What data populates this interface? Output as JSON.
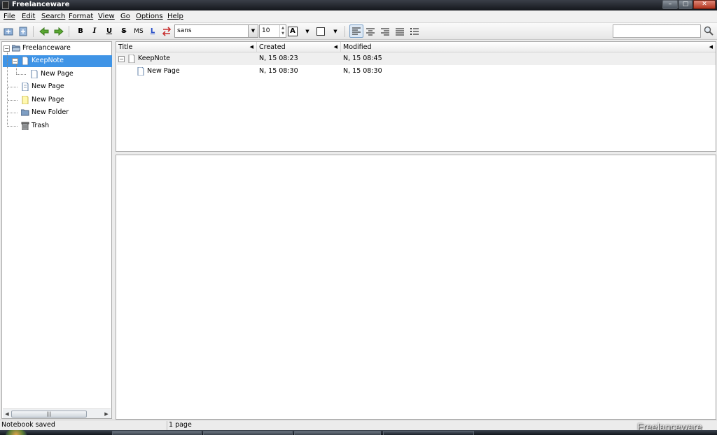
{
  "window": {
    "title": "Freelanceware",
    "controls": {
      "minimize": "–",
      "maximize": "▢",
      "close": "✕"
    }
  },
  "menu": [
    "File",
    "Edit",
    "Search",
    "Format",
    "View",
    "Go",
    "Options",
    "Help"
  ],
  "toolbar": {
    "bold": "B",
    "italic": "I",
    "underline": "U",
    "strike": "S",
    "monospace": "MS",
    "link": "L",
    "font_color_label": "A",
    "font_family": "sans",
    "font_size": "10"
  },
  "tree": {
    "root": "Freelanceware",
    "items": [
      {
        "label": "KeepNote",
        "level": 1,
        "icon": "page-icon",
        "selected": true
      },
      {
        "label": "New Page",
        "level": 2,
        "icon": "page-icon"
      },
      {
        "label": "New Page",
        "level": 1,
        "icon": "page-icon"
      },
      {
        "label": "New Page",
        "level": 1,
        "icon": "yellow-page-icon"
      },
      {
        "label": "New Folder",
        "level": 1,
        "icon": "folder-icon"
      },
      {
        "label": "Trash",
        "level": 1,
        "icon": "trash-icon"
      }
    ]
  },
  "list": {
    "columns": [
      "Title",
      "Created",
      "Modified"
    ],
    "rows": [
      {
        "title": "KeepNote",
        "created": "N, 15 08:23",
        "modified": "N, 15 08:45"
      },
      {
        "title": "New Page",
        "created": "N, 15 08:30",
        "modified": "N, 15 08:30"
      }
    ]
  },
  "status": {
    "left": "Notebook saved",
    "middle": "1 page"
  },
  "watermark": "Freelanceware",
  "colors": {
    "selection": "#3f94e6",
    "arrow_green": "#5aa832"
  }
}
